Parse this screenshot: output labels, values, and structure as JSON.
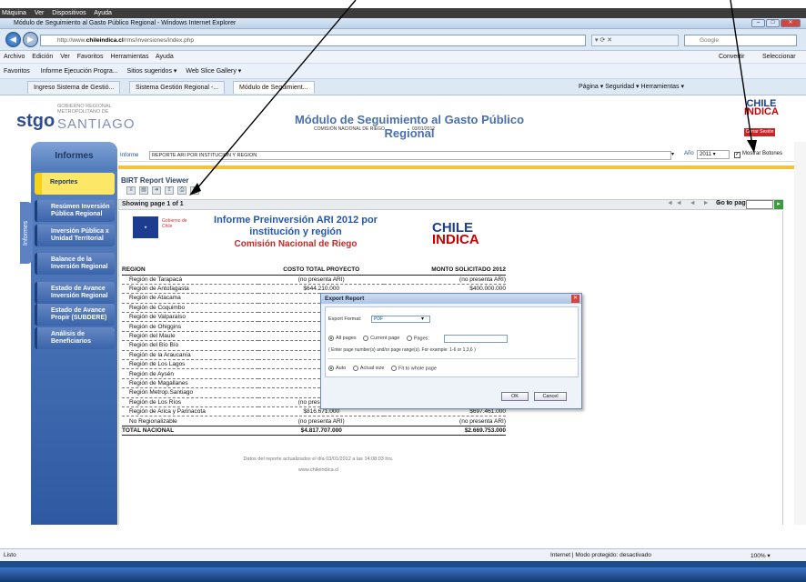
{
  "vm_menu": {
    "items": [
      "Máquina",
      "Ver",
      "Dispositivos",
      "Ayuda"
    ]
  },
  "window": {
    "title": "Módulo de Seguimiento al Gasto Público Regional - Windows Internet Explorer",
    "min": "–",
    "max": "□",
    "close": "✕"
  },
  "address": {
    "url_prefix": "http://www.",
    "url_domain": "chileindica.cl",
    "url_path": "/rms/inversiones/index.php",
    "search_placeholder": "Google"
  },
  "menubar": {
    "items": [
      "Archivo",
      "Edición",
      "Ver",
      "Favoritos",
      "Herramientas",
      "Ayuda"
    ],
    "convert": "Convertir",
    "select": "Seleccionar"
  },
  "favorites": {
    "label": "Favoritos",
    "items": [
      "Informe Ejecución Progra...",
      "Sitios sugeridos ▾",
      "Web Slice Gallery ▾"
    ]
  },
  "tabs": {
    "items": [
      "Ingreso Sistema de Gestió...",
      "Sistema Gestión Regional -...",
      "Módulo de Seguimient..."
    ],
    "tools": "Página ▾   Seguridad ▾   Herramientas ▾"
  },
  "header": {
    "logo": "stgo",
    "gov_line1": "GOBIERNO REGIONAL",
    "gov_line2": "METROPOLITANO DE",
    "city": "SANTIAGO",
    "title": "Módulo de Seguimiento al Gasto Público Regional",
    "subtitle": "COMISIÓN NACIONAL DE RIEGO",
    "date": "03/01/2012",
    "chile_logo_top": "CHILE",
    "chile_logo_bottom": "INDICA",
    "logout": "Cerrar Sesión"
  },
  "sidebar": {
    "heading": "Informes",
    "vertical_tab": "Informes",
    "items": [
      {
        "label": "Reportes"
      },
      {
        "label": "Resúmen Inversión Pública Regional"
      },
      {
        "label": "Inversión Pública x Unidad Territorial"
      },
      {
        "label": "Balance de la Inversión Regional"
      },
      {
        "label": "Estado de Avance Inversión Regional"
      },
      {
        "label": "Estado de Avance Propir (SUBDERE)"
      },
      {
        "label": "Análisis de Beneficiarios"
      }
    ]
  },
  "informe_bar": {
    "label": "Informe",
    "value": "REPORTE ARI POR INSTITUCION Y REGION",
    "year_label": "Año",
    "year_value": "2011 ▾",
    "show_buttons": "Mostrar Botones"
  },
  "birt": {
    "title": "BIRT Report Viewer",
    "page_info": "Showing page  1  of  1",
    "goto_label": "Go to page:",
    "go": "▸",
    "nav": "◄◄ ◄ ► ►►"
  },
  "report": {
    "gov_label": "Gobierno de Chile",
    "title_line1": "Informe Preinversión ARI 2012 por",
    "title_line2": "institución y región",
    "org": "Comisión Nacional de Riego",
    "logo_top": "CHILE",
    "logo_bottom": "INDICA",
    "columns": [
      "REGION",
      "COSTO TOTAL PROYECTO",
      "MONTO SOLICITADO 2012"
    ],
    "rows": [
      [
        "Región de Tarapacá",
        "(no presenta ARI)",
        "(no presenta ARI)"
      ],
      [
        "Región de Antofagasta",
        "$644.210.000",
        "$400.000.000"
      ],
      [
        "Región de Atacama",
        "",
        ""
      ],
      [
        "Región de Coquimbo",
        "",
        ""
      ],
      [
        "Región de Valparaíso",
        "",
        ""
      ],
      [
        "Región de Ohiggins",
        "",
        ""
      ],
      [
        "Región del Maule",
        "",
        ""
      ],
      [
        "Región del Bío Bío",
        "",
        ""
      ],
      [
        "Región de la Araucanía",
        "",
        ""
      ],
      [
        "Región de Los Lagos",
        "",
        ""
      ],
      [
        "Región de Aysén",
        "",
        ""
      ],
      [
        "Región de Magallanes",
        "",
        ""
      ],
      [
        "Región Metrop.Santiago",
        "",
        ""
      ],
      [
        "Región de Los Ríos",
        "(no presenta ARI)",
        "(no presenta ARI)"
      ],
      [
        "Región de Arica y Parinacota",
        "$816.671.000",
        "$697.461.000"
      ],
      [
        "No Regionalizable",
        "(no presenta ARI)",
        "(no presenta ARI)"
      ]
    ],
    "total": [
      "TOTAL NACIONAL",
      "$4.817.707.000",
      "$2.669.753.000"
    ],
    "footnote1": "Datos del reporte actualizados el día 03/01/2012 a las 14:08:03 hrs.",
    "footnote2": "www.chileindica.cl"
  },
  "dialog": {
    "title": "Export Report",
    "close": "✕",
    "format_label": "Export Format:",
    "format_value": "PDF",
    "pages": [
      "All pages",
      "Current page",
      "Pages:"
    ],
    "hint": "( Enter page number(s) and/or page range(s). For example: 1-6 or 1,3,6 )",
    "size": [
      "Auto",
      "Actual size",
      "Fit to whole page"
    ],
    "ok": "OK",
    "cancel": "Cancel"
  },
  "status": {
    "left": "Listo",
    "right": "Internet | Modo protegido: desactivado",
    "zoom": "100% ▾"
  }
}
